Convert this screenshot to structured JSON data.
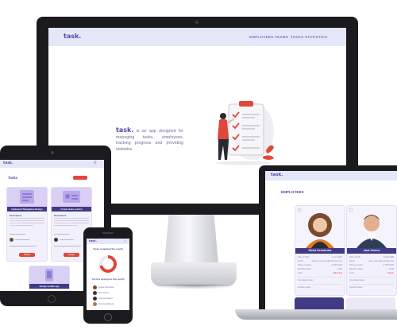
{
  "desktop": {
    "nav": {
      "logo": "task.",
      "links": [
        "EMPLOYEES",
        "TEAMS",
        "TASKS",
        "STATISTICS"
      ]
    },
    "hero": {
      "brand": "task.",
      "tagline": " is an app designed for managing tasks, employees, tracking progress and providing statistics"
    }
  },
  "tablet": {
    "logo": "task.",
    "heading": "Tasks",
    "cards": [
      {
        "title": "Implement Navigation Design",
        "section": "Description",
        "button": "Details"
      },
      {
        "title": "Create tasks section",
        "section": "Description",
        "button": "Details"
      },
      {
        "title": "Design mobile app",
        "section": "",
        "button": ""
      }
    ]
  },
  "phone": {
    "logo": "task.",
    "stat1": "Tasks completed this month",
    "stat2": "Top five employees this month",
    "employees": [
      "Sheila Hernández",
      "Jack Owens",
      "Joshua Howard",
      "Florence Wheeler"
    ]
  },
  "laptop": {
    "logo": "task.",
    "heading": "EMPLOYEES",
    "employees": [
      {
        "name": "Shela Hernández",
        "fields": [
          [
            "Date of birth",
            "11-11-1991"
          ],
          [
            "Email",
            "sheila_hernandez@example.com"
          ],
          [
            "Phone number",
            "+1 555 0123"
          ],
          [
            "Monthly salary",
            "3.000"
          ],
          [
            "Team",
            "Marketing"
          ]
        ],
        "completed": "Completed tasks",
        "pending": "Pending tasks"
      },
      {
        "name": "Jack Owens",
        "fields": [
          [
            "Date of birth",
            "04-05-1988"
          ],
          [
            "Email",
            "jack_owens@example.com"
          ],
          [
            "Phone number",
            "+1 555 0456"
          ],
          [
            "Monthly salary",
            "3.200"
          ],
          [
            "Team",
            "Design"
          ]
        ],
        "completed": "Completed tasks",
        "pending": "Pending tasks"
      }
    ]
  },
  "colors": {
    "brand": "#4f4aa5",
    "nav_bg": "#e4e7f8",
    "accent_red": "#e0473a",
    "card_purple": "#d9d0f3"
  }
}
